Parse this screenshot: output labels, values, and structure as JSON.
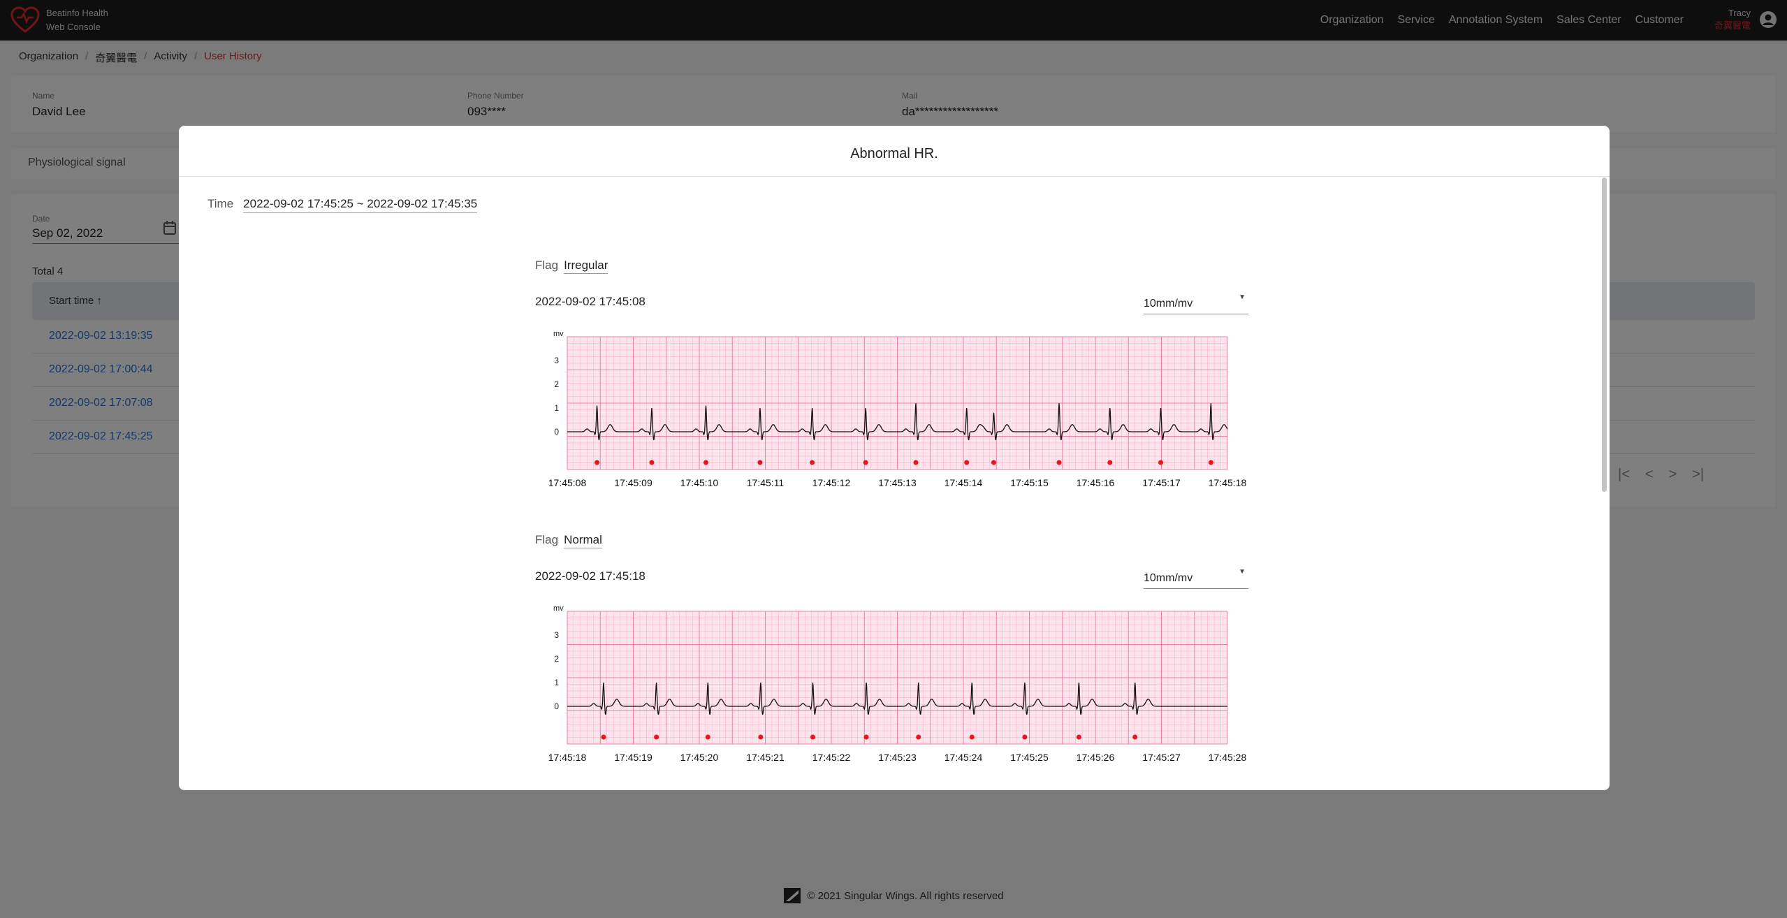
{
  "brand": {
    "line1": "Beatinfo Health",
    "line2": "Web Console"
  },
  "nav": [
    "Organization",
    "Service",
    "Annotation System",
    "Sales Center",
    "Customer"
  ],
  "user": {
    "name": "Tracy",
    "org": "奇翼醫電"
  },
  "breadcrumb": [
    "Organization",
    "奇翼醫電",
    "Activity",
    "User History"
  ],
  "profile": {
    "name_label": "Name",
    "name": "David Lee",
    "phone_label": "Phone Number",
    "phone": "093****",
    "mail_label": "Mail",
    "mail": "da******************"
  },
  "tabs": [
    "Physiological signal"
  ],
  "filter": {
    "date_label": "Date",
    "date": "Sep 02, 2022"
  },
  "list": {
    "total": "Total 4",
    "header": "Start time ↑",
    "rows": [
      "2022-09-02 13:19:35",
      "2022-09-02 17:00:44",
      "2022-09-02 17:07:08",
      "2022-09-02 17:45:25"
    ]
  },
  "footer": "© 2021 Singular Wings. All rights reserved",
  "modal": {
    "title": "Abnormal HR.",
    "time_label": "Time",
    "time_value": "2022-09-02 17:45:25 ~ 2022-09-02 17:45:35",
    "ecgs": [
      {
        "flag_label": "Flag",
        "flag": "Irregular",
        "timestamp": "2022-09-02 17:45:08",
        "scale": "10mm/mv",
        "chart_data": {
          "type": "line",
          "ylabel": "mv",
          "ylim": [
            -1,
            4
          ],
          "yticks": [
            0,
            1,
            2,
            3
          ],
          "xlim": [
            0,
            10
          ],
          "xticks": [
            "17:45:08",
            "17:45:09",
            "17:45:10",
            "17:45:11",
            "17:45:12",
            "17:45:13",
            "17:45:14",
            "17:45:15",
            "17:45:16",
            "17:45:17",
            "17:45:18"
          ],
          "r_peaks_s": [
            0.45,
            1.28,
            2.1,
            2.92,
            3.71,
            4.52,
            5.28,
            6.05,
            6.46,
            7.45,
            8.22,
            8.99,
            9.75
          ],
          "r_amplitudes": [
            1.1,
            1.0,
            1.1,
            1.0,
            1.0,
            1.0,
            1.2,
            1.0,
            0.8,
            1.2,
            1.0,
            1.0,
            1.2
          ],
          "color_signal": "#111111",
          "color_grid": "#e8789a",
          "color_bg": "#fde4ec",
          "color_marker": "#e8141e"
        }
      },
      {
        "flag_label": "Flag",
        "flag": "Normal",
        "timestamp": "2022-09-02 17:45:18",
        "scale": "10mm/mv",
        "chart_data": {
          "type": "line",
          "ylabel": "mv",
          "ylim": [
            -1,
            4
          ],
          "yticks": [
            0,
            1,
            2,
            3
          ],
          "xlim": [
            0,
            10
          ],
          "xticks": [
            "17:45:18",
            "17:45:19",
            "17:45:20",
            "17:45:21",
            "17:45:22",
            "17:45:23",
            "17:45:24",
            "17:45:25",
            "17:45:26",
            "17:45:27",
            "17:45:28"
          ],
          "r_peaks_s": [
            0.55,
            1.35,
            2.13,
            2.93,
            3.72,
            4.53,
            5.32,
            6.13,
            6.93,
            7.75,
            8.6
          ],
          "r_amplitudes": [
            1.0,
            1.0,
            1.0,
            1.0,
            1.0,
            1.0,
            1.0,
            1.0,
            1.0,
            1.0,
            1.0
          ],
          "color_signal": "#111111",
          "color_grid": "#e8789a",
          "color_bg": "#fde4ec",
          "color_marker": "#e8141e"
        }
      }
    ]
  }
}
